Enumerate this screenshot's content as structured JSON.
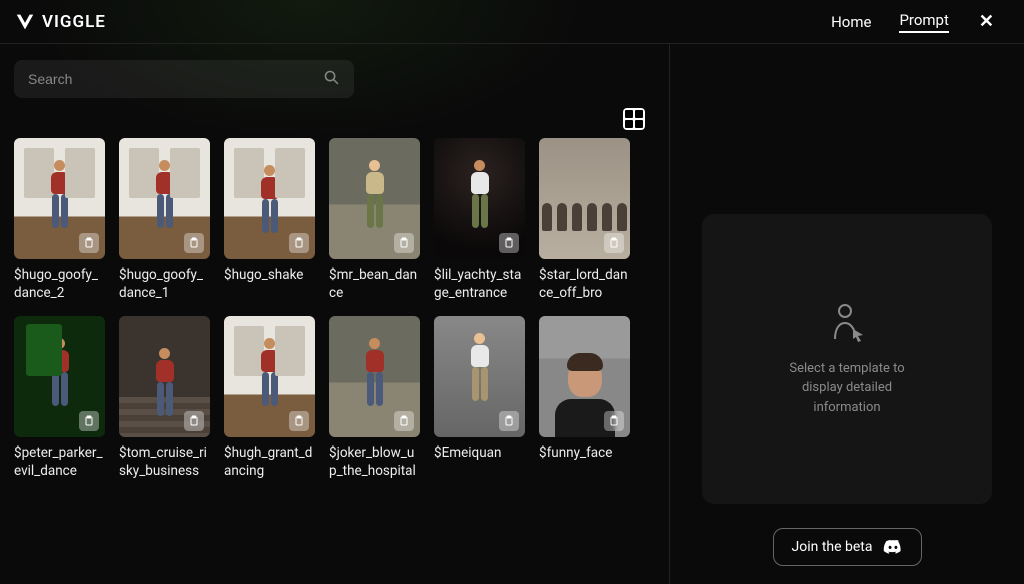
{
  "brand": "VIGGLE",
  "nav": {
    "home": "Home",
    "prompt": "Prompt"
  },
  "search": {
    "placeholder": "Search"
  },
  "templates": [
    {
      "label": "$hugo_goofy_dance_2"
    },
    {
      "label": "$hugo_goofy_dance_1"
    },
    {
      "label": "$hugo_shake"
    },
    {
      "label": "$mr_bean_dance"
    },
    {
      "label": "$lil_yachty_stage_entrance"
    },
    {
      "label": "$star_lord_dance_off_bro"
    },
    {
      "label": "$peter_parker_evil_dance"
    },
    {
      "label": "$tom_cruise_risky_business"
    },
    {
      "label": "$hugh_grant_dancing"
    },
    {
      "label": "$joker_blow_up_the_hospital"
    },
    {
      "label": "$Emeiquan"
    },
    {
      "label": "$funny_face"
    }
  ],
  "placeholder": {
    "text": "Select a template to display detailed information"
  },
  "cta": {
    "join": "Join the beta"
  }
}
